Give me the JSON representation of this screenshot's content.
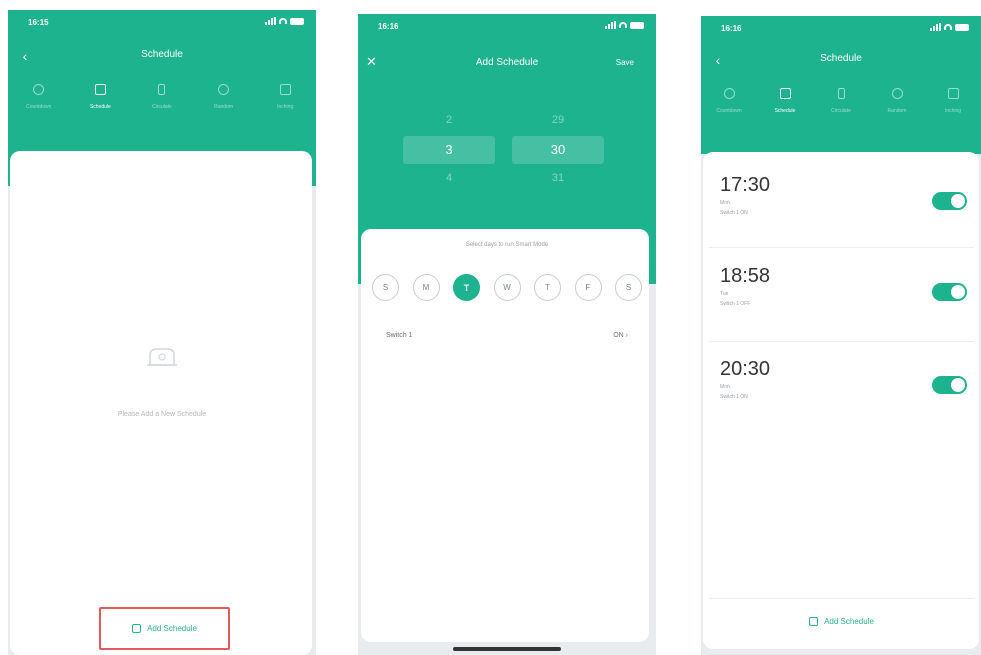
{
  "accent_color": "#1db38e",
  "highlight_color": "#e35a5a",
  "screen1": {
    "time": "16:15",
    "title": "Schedule",
    "tabs": [
      {
        "label": "Countdown",
        "icon": "clock-icon"
      },
      {
        "label": "Schedule",
        "icon": "calendar-icon",
        "active": true
      },
      {
        "label": "Circulate",
        "icon": "hourglass-icon"
      },
      {
        "label": "Random",
        "icon": "random-icon"
      },
      {
        "label": "Inching",
        "icon": "inching-icon"
      }
    ],
    "empty_text": "Please Add a New Schedule",
    "add_label": "Add Schedule"
  },
  "screen2": {
    "time": "16:16",
    "title": "Add Schedule",
    "save_label": "Save",
    "picker": {
      "hours": [
        "",
        "2",
        "3",
        "4",
        ""
      ],
      "minutes": [
        "",
        "29",
        "30",
        "31",
        ""
      ]
    },
    "days_label": "Select days to run Smart Mode",
    "days": [
      "S",
      "M",
      "T",
      "W",
      "T",
      "F",
      "S"
    ],
    "switch_label": "Switch 1",
    "switch_value": "ON ›"
  },
  "screen3": {
    "time": "16:16",
    "title": "Schedule",
    "tabs": [
      {
        "label": "Countdown"
      },
      {
        "label": "Schedule",
        "active": true
      },
      {
        "label": "Circulate"
      },
      {
        "label": "Random"
      },
      {
        "label": "Inching"
      }
    ],
    "schedules": [
      {
        "time": "17:30",
        "days": "Mon",
        "action": "Switch 1 ON",
        "enabled": true
      },
      {
        "time": "18:58",
        "days": "Tue",
        "action": "Switch 1 OFF",
        "enabled": true
      },
      {
        "time": "20:30",
        "days": "Mon",
        "action": "Switch 1 ON",
        "enabled": true
      }
    ],
    "add_label": "Add Schedule"
  }
}
